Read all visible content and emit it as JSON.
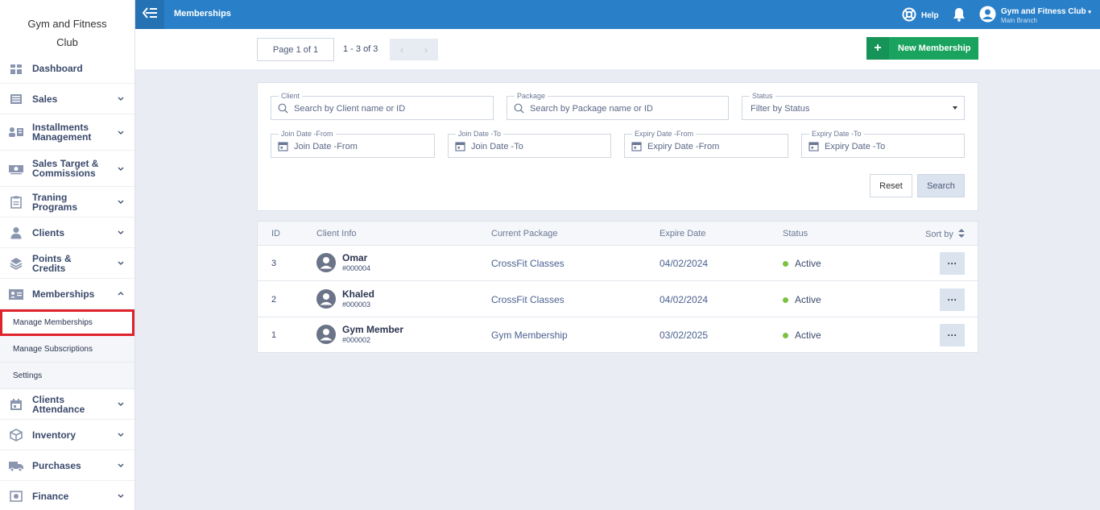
{
  "brand": {
    "line1": "Gym and Fitness",
    "line2": "Club"
  },
  "sidebar": {
    "items": [
      {
        "label": "Dashboard",
        "icon": "dashboard-icon"
      },
      {
        "label": "Sales",
        "icon": "sales-icon"
      },
      {
        "label": "Installments Management",
        "icon": "installments-icon"
      },
      {
        "label": "Sales Target & Commissions",
        "icon": "cash-icon"
      },
      {
        "label": "Traning Programs",
        "icon": "clipboard-icon"
      },
      {
        "label": "Clients",
        "icon": "user-icon"
      },
      {
        "label": "Points & Credits",
        "icon": "layers-icon"
      },
      {
        "label": "Memberships",
        "icon": "id-card-icon"
      },
      {
        "label": "Clients Attendance",
        "icon": "calendar-icon"
      },
      {
        "label": "Inventory",
        "icon": "box-icon"
      },
      {
        "label": "Purchases",
        "icon": "truck-icon"
      },
      {
        "label": "Finance",
        "icon": "safe-icon"
      }
    ],
    "memberships_sub": [
      {
        "label": "Manage Memberships"
      },
      {
        "label": "Manage Subscriptions"
      },
      {
        "label": "Settings"
      }
    ]
  },
  "topbar": {
    "title": "Memberships",
    "help": "Help",
    "user_name": "Gym and Fitness Club",
    "user_branch": "Main Branch"
  },
  "pager": {
    "page_label": "Page 1 of 1",
    "count_label": "1 - 3 of 3",
    "prev": "‹",
    "next": "›"
  },
  "actions": {
    "new_membership": "New Membership",
    "plus": "+"
  },
  "filters": {
    "client": {
      "label": "Client",
      "placeholder": "Search by Client name or ID"
    },
    "package": {
      "label": "Package",
      "placeholder": "Search by Package name or ID"
    },
    "status": {
      "label": "Status",
      "placeholder": "Filter by Status"
    },
    "join_from": {
      "label": "Join Date -From",
      "placeholder": "Join Date -From"
    },
    "join_to": {
      "label": "Join Date -To",
      "placeholder": "Join Date -To"
    },
    "expiry_from": {
      "label": "Expiry Date -From",
      "placeholder": "Expiry Date -From"
    },
    "expiry_to": {
      "label": "Expiry Date -To",
      "placeholder": "Expiry Date -To"
    },
    "reset": "Reset",
    "search": "Search"
  },
  "table": {
    "headers": {
      "id": "ID",
      "client": "Client Info",
      "package": "Current Package",
      "expire": "Expire Date",
      "status": "Status",
      "sort": "Sort by"
    },
    "rows": [
      {
        "id": "3",
        "name": "Omar",
        "number": "#000004",
        "package": "CrossFit Classes",
        "expire": "04/02/2024",
        "status": "Active",
        "more": "···"
      },
      {
        "id": "2",
        "name": "Khaled",
        "number": "#000003",
        "package": "CrossFit Classes",
        "expire": "04/02/2024",
        "status": "Active",
        "more": "···"
      },
      {
        "id": "1",
        "name": "Gym Member",
        "number": "#000002",
        "package": "Gym Membership",
        "expire": "03/02/2025",
        "status": "Active",
        "more": "···"
      }
    ]
  },
  "colors": {
    "topbar": "#2a80c8",
    "accent_green": "#1aa35f",
    "active_dot": "#7cc242",
    "highlight_red": "#e0222b"
  }
}
